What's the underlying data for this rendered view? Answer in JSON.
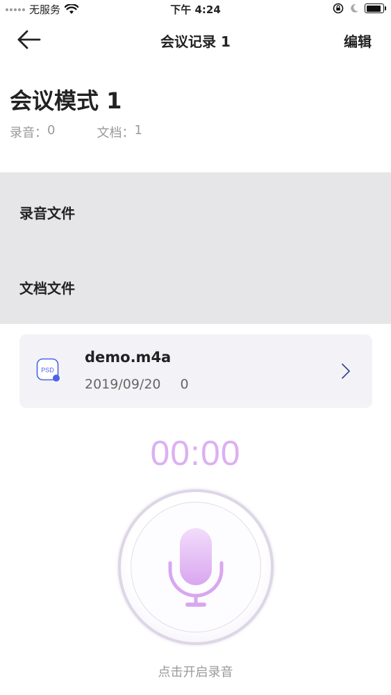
{
  "status_bar": {
    "carrier": "无服务",
    "time": "下午 4:24"
  },
  "nav": {
    "title": "会议记录 1",
    "edit_label": "编辑"
  },
  "meeting": {
    "title": "会议模式 1",
    "recordings_label": "录音：",
    "recordings_count": "0",
    "documents_label": "文档：",
    "documents_count": "1"
  },
  "sections": {
    "recordings": "录音文件",
    "documents": "文档文件"
  },
  "file": {
    "icon_text": "PSD",
    "name": "demo.m4a",
    "date": "2019/09/20",
    "size": "0"
  },
  "recorder": {
    "timer": "00:00",
    "hint": "点击开启录音"
  },
  "colors": {
    "accent_purple": "#d9a6f0",
    "file_icon_blue": "#4b63e6",
    "section_bg": "#e6e6e8"
  }
}
